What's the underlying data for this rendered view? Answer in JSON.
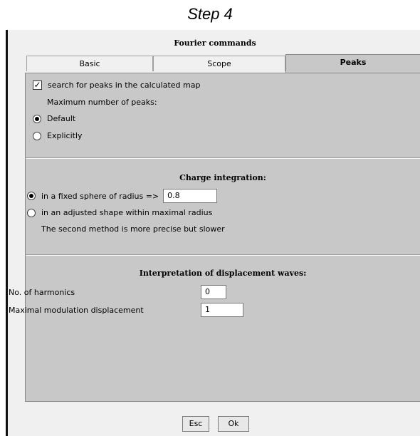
{
  "caption": "Step 4",
  "window": {
    "title": "Fourier commands"
  },
  "tabs": [
    {
      "label": "Basic",
      "active": false
    },
    {
      "label": "Scope",
      "active": false
    },
    {
      "label": "Peaks",
      "active": true
    }
  ],
  "peaks": {
    "search_checkbox": {
      "label": "search for peaks in the calculated map",
      "checked": true
    },
    "max_peaks_label": "Maximum number of peaks:",
    "options": [
      {
        "label": "Default",
        "selected": true
      },
      {
        "label": "Explicitly",
        "selected": false
      }
    ]
  },
  "charge": {
    "title": "Charge integration:",
    "options": [
      {
        "label": "in a fixed sphere of radius  =>",
        "selected": true
      },
      {
        "label": "in an adjusted shape within maximal radius",
        "selected": false
      }
    ],
    "radius_value": "0.8",
    "note": "The second method is more precise but slower"
  },
  "waves": {
    "title": "Interpretation of displacement waves:",
    "harmonics_label": "No. of harmonics",
    "harmonics_value": "0",
    "displacement_label": "Maximal modulation displacement",
    "displacement_value": "1"
  },
  "buttons": {
    "esc": "Esc",
    "ok": "Ok"
  }
}
